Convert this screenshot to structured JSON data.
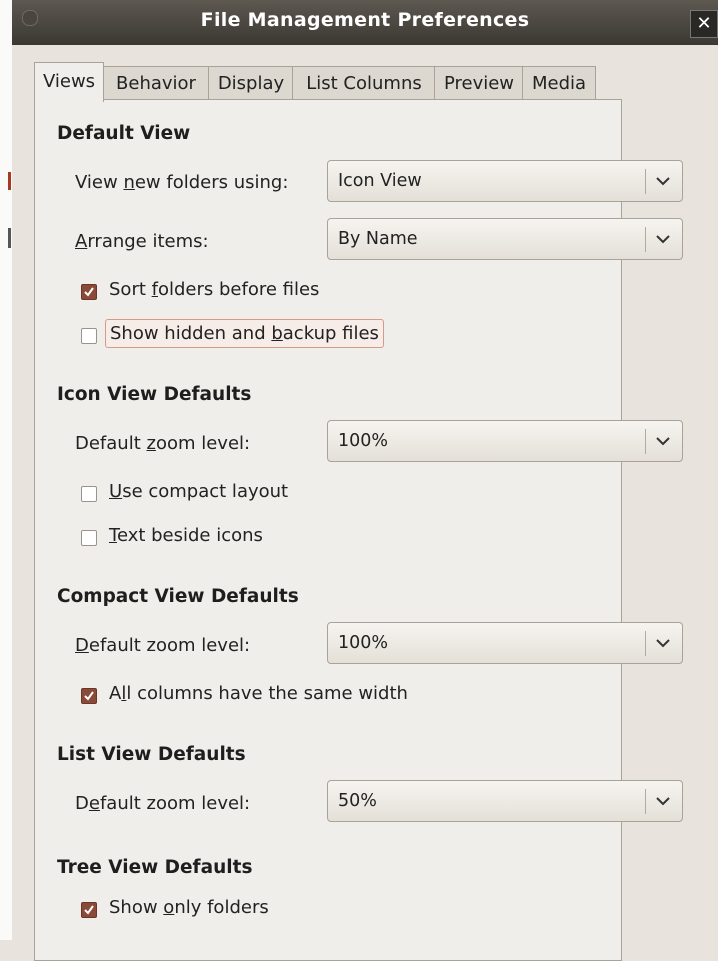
{
  "window": {
    "title": "File Management Preferences",
    "close_glyph": "✕"
  },
  "tabs": [
    "Views",
    "Behavior",
    "Display",
    "List Columns",
    "Preview",
    "Media"
  ],
  "active_tab": "Views",
  "default_view": {
    "heading": "Default View",
    "view_new_folders": {
      "label_pre": "View ",
      "label_u": "n",
      "label_post": "ew folders using:",
      "value": "Icon View"
    },
    "arrange_items": {
      "label_pre": "",
      "label_u": "A",
      "label_post": "rrange items:",
      "value": "By Name"
    },
    "sort_folders": {
      "pre": "Sort ",
      "u": "f",
      "post": "olders before files",
      "checked": true
    },
    "show_hidden": {
      "pre": "Show hidden and ",
      "u": "b",
      "post": "ackup files",
      "checked": false
    }
  },
  "icon_view": {
    "heading": "Icon View Defaults",
    "zoom": {
      "label_pre": "Default ",
      "label_u": "z",
      "label_post": "oom level:",
      "value": "100%"
    },
    "compact_layout": {
      "pre": "",
      "u": "U",
      "post": "se compact layout",
      "checked": false
    },
    "text_beside": {
      "pre": "",
      "u": "T",
      "post": "ext beside icons",
      "checked": false
    }
  },
  "compact_view": {
    "heading": "Compact View Defaults",
    "zoom": {
      "label_pre": "",
      "label_u": "D",
      "label_post": "efault zoom level:",
      "value": "100%"
    },
    "same_width": {
      "pre": "A",
      "u": "l",
      "post": "l columns have the same width",
      "checked": true
    }
  },
  "list_view": {
    "heading": "List View Defaults",
    "zoom": {
      "label_pre": "D",
      "label_u": "e",
      "label_post": "fault zoom level:",
      "value": "50%"
    }
  },
  "tree_view": {
    "heading": "Tree View Defaults",
    "only_folders": {
      "pre": "Show ",
      "u": "o",
      "post": "nly folders",
      "checked": true
    }
  },
  "colors": {
    "titlebar": "#3b3833",
    "background": "#e8e4dd",
    "panel": "#f0eeea",
    "checkbox_checked": "#8a4a38",
    "focus_border": "#d89a88"
  }
}
